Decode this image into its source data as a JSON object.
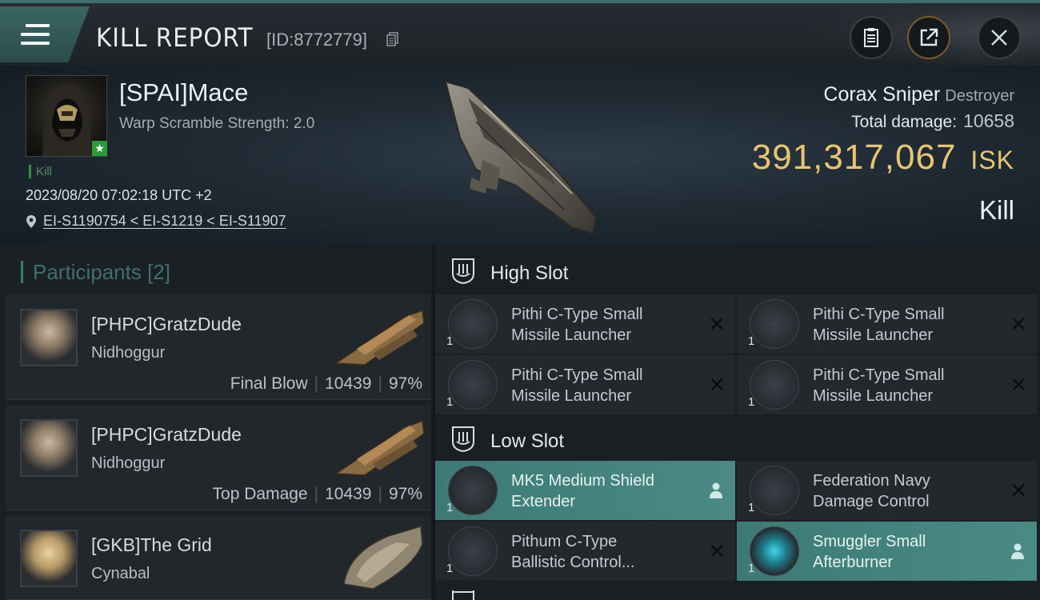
{
  "titlebar": {
    "title": "KILL REPORT",
    "report_id": "[ID:8772779]"
  },
  "victim": {
    "name": "[SPAI]Mace",
    "warp_scramble": "Warp Scramble Strength: 2.0",
    "tag": "Kill",
    "timestamp": "2023/08/20 07:02:18 UTC +2",
    "location": "EI-S1190754 < EI-S1219 < EI-S11907",
    "ship_name": "Corax Sniper",
    "ship_class": "Destroyer",
    "total_damage_label": "Total damage:",
    "total_damage": "10658",
    "isk_value": "391,317,067",
    "isk_unit": "ISK",
    "result": "Kill"
  },
  "participants": {
    "header": "Participants",
    "count": "[2]",
    "items": [
      {
        "name": "[PHPC]GratzDude",
        "ship": "Nidhoggur",
        "role": "Final Blow",
        "damage": "10439",
        "percent": "97%"
      },
      {
        "name": "[PHPC]GratzDude",
        "ship": "Nidhoggur",
        "role": "Top Damage",
        "damage": "10439",
        "percent": "97%"
      },
      {
        "name": "[GKB]The Grid",
        "ship": "Cynabal"
      }
    ]
  },
  "fitting": {
    "high_slot": {
      "label": "High Slot",
      "modules": [
        {
          "line1": "Pithi C-Type Small",
          "line2": "Missile Launcher",
          "qty": "1"
        },
        {
          "line1": "Pithi C-Type Small",
          "line2": "Missile Launcher",
          "qty": "1"
        },
        {
          "line1": "Pithi C-Type Small",
          "line2": "Missile Launcher",
          "qty": "1"
        },
        {
          "line1": "Pithi C-Type Small",
          "line2": "Missile Launcher",
          "qty": "1"
        }
      ]
    },
    "low_slot": {
      "label": "Low Slot",
      "modules": [
        {
          "line1": "MK5 Medium Shield",
          "line2": "Extender",
          "qty": "1"
        },
        {
          "line1": "Federation Navy",
          "line2": "Damage Control",
          "qty": "1"
        },
        {
          "line1": "Pithum C-Type",
          "line2": "Ballistic Control...",
          "qty": "1"
        },
        {
          "line1": "Smuggler Small",
          "line2": "Afterburner",
          "qty": "1"
        }
      ]
    }
  },
  "colors": {
    "accent_teal": "#3f7573",
    "isk_gold": "#e8c56f",
    "fitted_highlight": "#4a8a85",
    "kill_green": "#2e9b3a"
  }
}
